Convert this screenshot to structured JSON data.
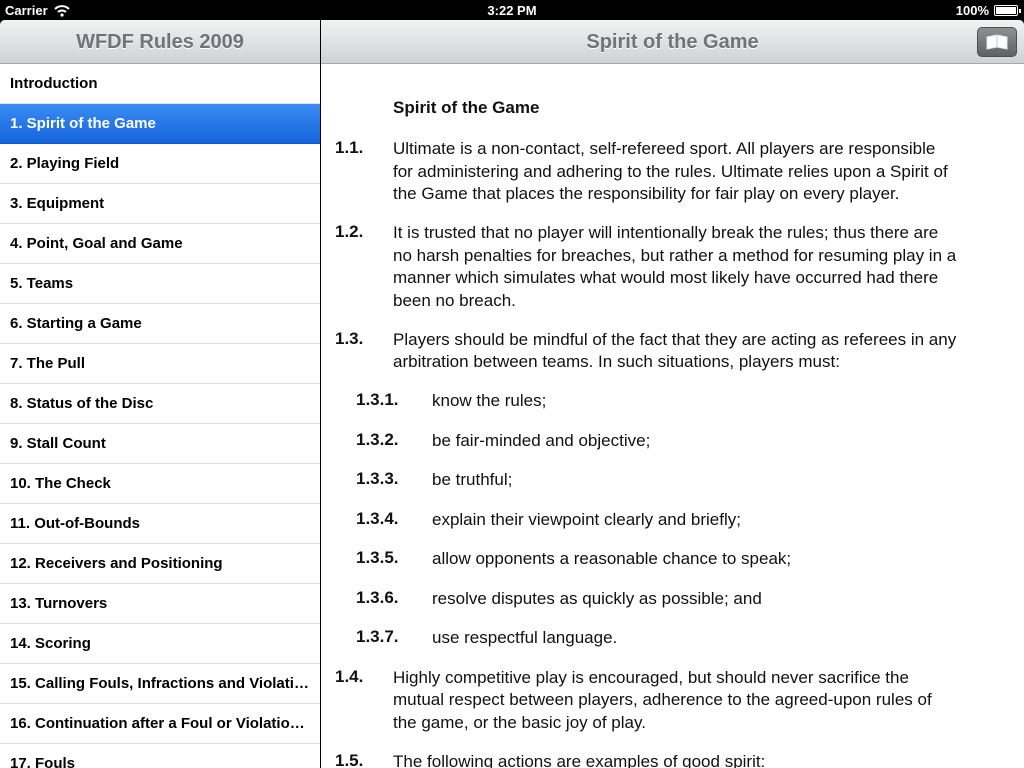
{
  "status": {
    "carrier": "Carrier",
    "time": "3:22 PM",
    "battery": "100%",
    "wifi_icon": "wifi-icon"
  },
  "master": {
    "title": "WFDF Rules 2009",
    "items": [
      "Introduction",
      "1. Spirit of the Game",
      "2. Playing Field",
      "3. Equipment",
      "4. Point, Goal and Game",
      "5. Teams",
      "6. Starting a Game",
      "7. The Pull",
      "8. Status of the Disc",
      "9. Stall Count",
      "10. The Check",
      "11. Out-of-Bounds",
      "12. Receivers and Positioning",
      "13. Turnovers",
      "14. Scoring",
      "15. Calling Fouls, Infractions and Violati…",
      "16. Continuation after a Foul or Violatio…",
      "17. Fouls"
    ],
    "selected_index": 1
  },
  "detail": {
    "title": "Spirit of the Game",
    "toolbar_icon": "book-icon",
    "section_heading": "Spirit of the Game",
    "rules": [
      {
        "num": "1.1.",
        "lines": [
          "Ultimate is a non-contact, self-refereed sport. All players are responsible",
          "for administering and adhering to the rules. Ultimate relies upon a Spirit of",
          "the Game that places the responsibility for fair play on every player."
        ]
      },
      {
        "num": "1.2.",
        "lines": [
          "It is trusted that no player will intentionally break the rules; thus there are",
          "no harsh penalties for breaches, but rather a method for resuming play in a",
          "manner which simulates what would most likely have occurred had there",
          "been no breach."
        ]
      },
      {
        "num": "1.3.",
        "lines": [
          "Players should be mindful of the fact that they are acting as referees in any",
          "arbitration between teams. In such situations, players must:"
        ]
      },
      {
        "num": "1.3.1.",
        "lines": [
          "know the rules;"
        ]
      },
      {
        "num": "1.3.2.",
        "lines": [
          "be fair-minded and objective;"
        ]
      },
      {
        "num": "1.3.3.",
        "lines": [
          "be truthful;"
        ]
      },
      {
        "num": "1.3.4.",
        "lines": [
          "explain their viewpoint clearly and briefly;"
        ]
      },
      {
        "num": "1.3.5.",
        "lines": [
          "allow opponents a reasonable chance to speak;"
        ]
      },
      {
        "num": "1.3.6.",
        "lines": [
          "resolve disputes as quickly as possible; and"
        ]
      },
      {
        "num": "1.3.7.",
        "lines": [
          "use respectful language."
        ]
      },
      {
        "num": "1.4.",
        "lines": [
          "Highly competitive play is encouraged, but should never sacrifice the",
          "mutual respect between players, adherence to the agreed-upon rules of",
          "the game, or the basic joy of play."
        ]
      },
      {
        "num": "1.5.",
        "lines": [
          "The following actions are examples of good spirit:"
        ]
      }
    ]
  }
}
